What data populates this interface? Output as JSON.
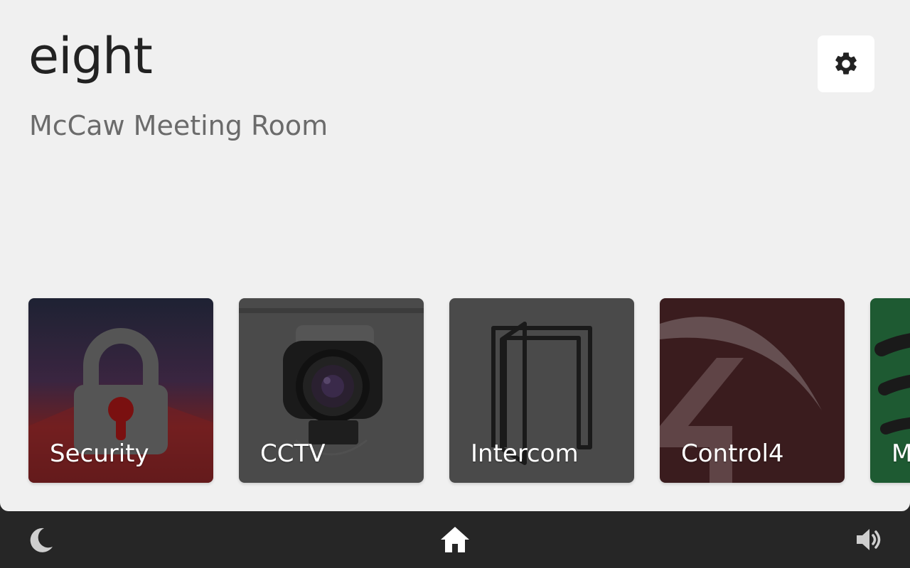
{
  "header": {
    "room_name": "eight",
    "room_subtitle": "McCaw Meeting Room",
    "settings_icon": "gear-icon"
  },
  "tiles": [
    {
      "label": "Security",
      "icon": "padlock-icon",
      "color": "#2a2030"
    },
    {
      "label": "CCTV",
      "icon": "camera-icon",
      "color": "#4a4a4a"
    },
    {
      "label": "Intercom",
      "icon": "door-icon",
      "color": "#4a4a4a"
    },
    {
      "label": "Control4",
      "icon": "control4-logo-icon",
      "color": "#3a1c1e"
    },
    {
      "label": "M",
      "icon": "spotify-logo-icon",
      "color": "#1e5a32"
    }
  ],
  "bottom_bar": {
    "left_icon": "moon-icon",
    "center_icon": "home-icon",
    "right_icon": "volume-icon"
  },
  "colors": {
    "background": "#f0f0f0",
    "bar": "#262626",
    "title": "#222222",
    "subtitle": "#6b6b6b"
  }
}
